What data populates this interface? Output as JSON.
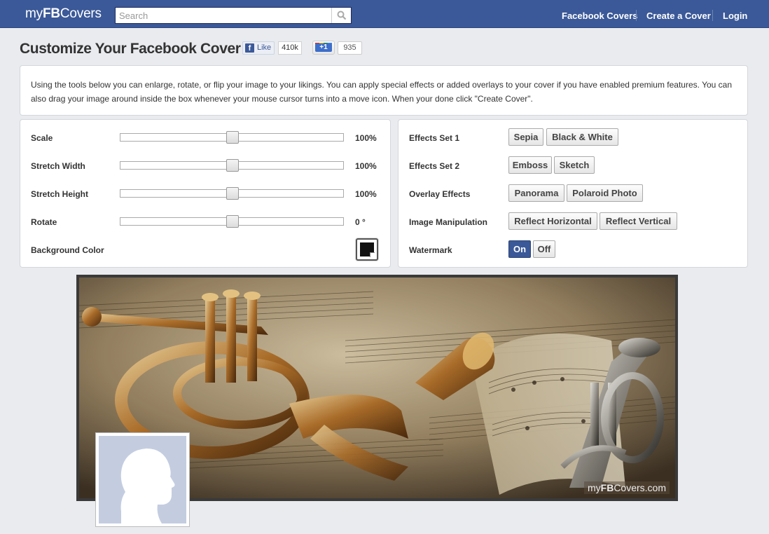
{
  "header": {
    "logo_prefix": "my",
    "logo_bold": "FB",
    "logo_suffix": "Covers",
    "search_placeholder": "Search",
    "nav": [
      "Facebook Covers",
      "Create a Cover",
      "Login"
    ]
  },
  "title_row": {
    "page_title": "Customize Your Facebook Cover",
    "like_label": "Like",
    "like_count": "410k",
    "gplus_label": "+1",
    "gplus_count": "935"
  },
  "intro": {
    "text": "Using the tools below you can enlarge, rotate, or flip your image to your likings. You can apply special effects or added overlays to your cover if you have enabled premium features. You can also drag your image around inside the box whenever your mouse cursor turns into a move icon. When your done click \"Create Cover\"."
  },
  "controls": {
    "sliders": [
      {
        "label": "Scale",
        "value": "100%",
        "level": 0.5
      },
      {
        "label": "Stretch Width",
        "value": "100%",
        "level": 0.5
      },
      {
        "label": "Stretch Height",
        "value": "100%",
        "level": 0.5
      },
      {
        "label": "Rotate",
        "value": "0 °",
        "level": 0.5
      }
    ],
    "background_color_label": "Background Color",
    "background_color": "#111111"
  },
  "effects": {
    "rows": [
      {
        "label": "Effects Set 1",
        "buttons": [
          "Sepia",
          "Black & White"
        ]
      },
      {
        "label": "Effects Set 2",
        "buttons": [
          "Emboss",
          "Sketch"
        ]
      },
      {
        "label": "Overlay Effects",
        "buttons": [
          "Panorama",
          "Polaroid Photo"
        ]
      },
      {
        "label": "Image Manipulation",
        "buttons": [
          "Reflect Horizontal",
          "Reflect Vertical"
        ]
      },
      {
        "label": "Watermark",
        "buttons": [
          "On",
          "Off"
        ],
        "active": "On"
      }
    ]
  },
  "cover": {
    "watermark_prefix": "my",
    "watermark_bold": "FB",
    "watermark_suffix": "Covers.com"
  },
  "colors": {
    "header_blue": "#3b5998",
    "page_bg": "#e9ebee",
    "profile_placeholder": "#c4cde0"
  }
}
